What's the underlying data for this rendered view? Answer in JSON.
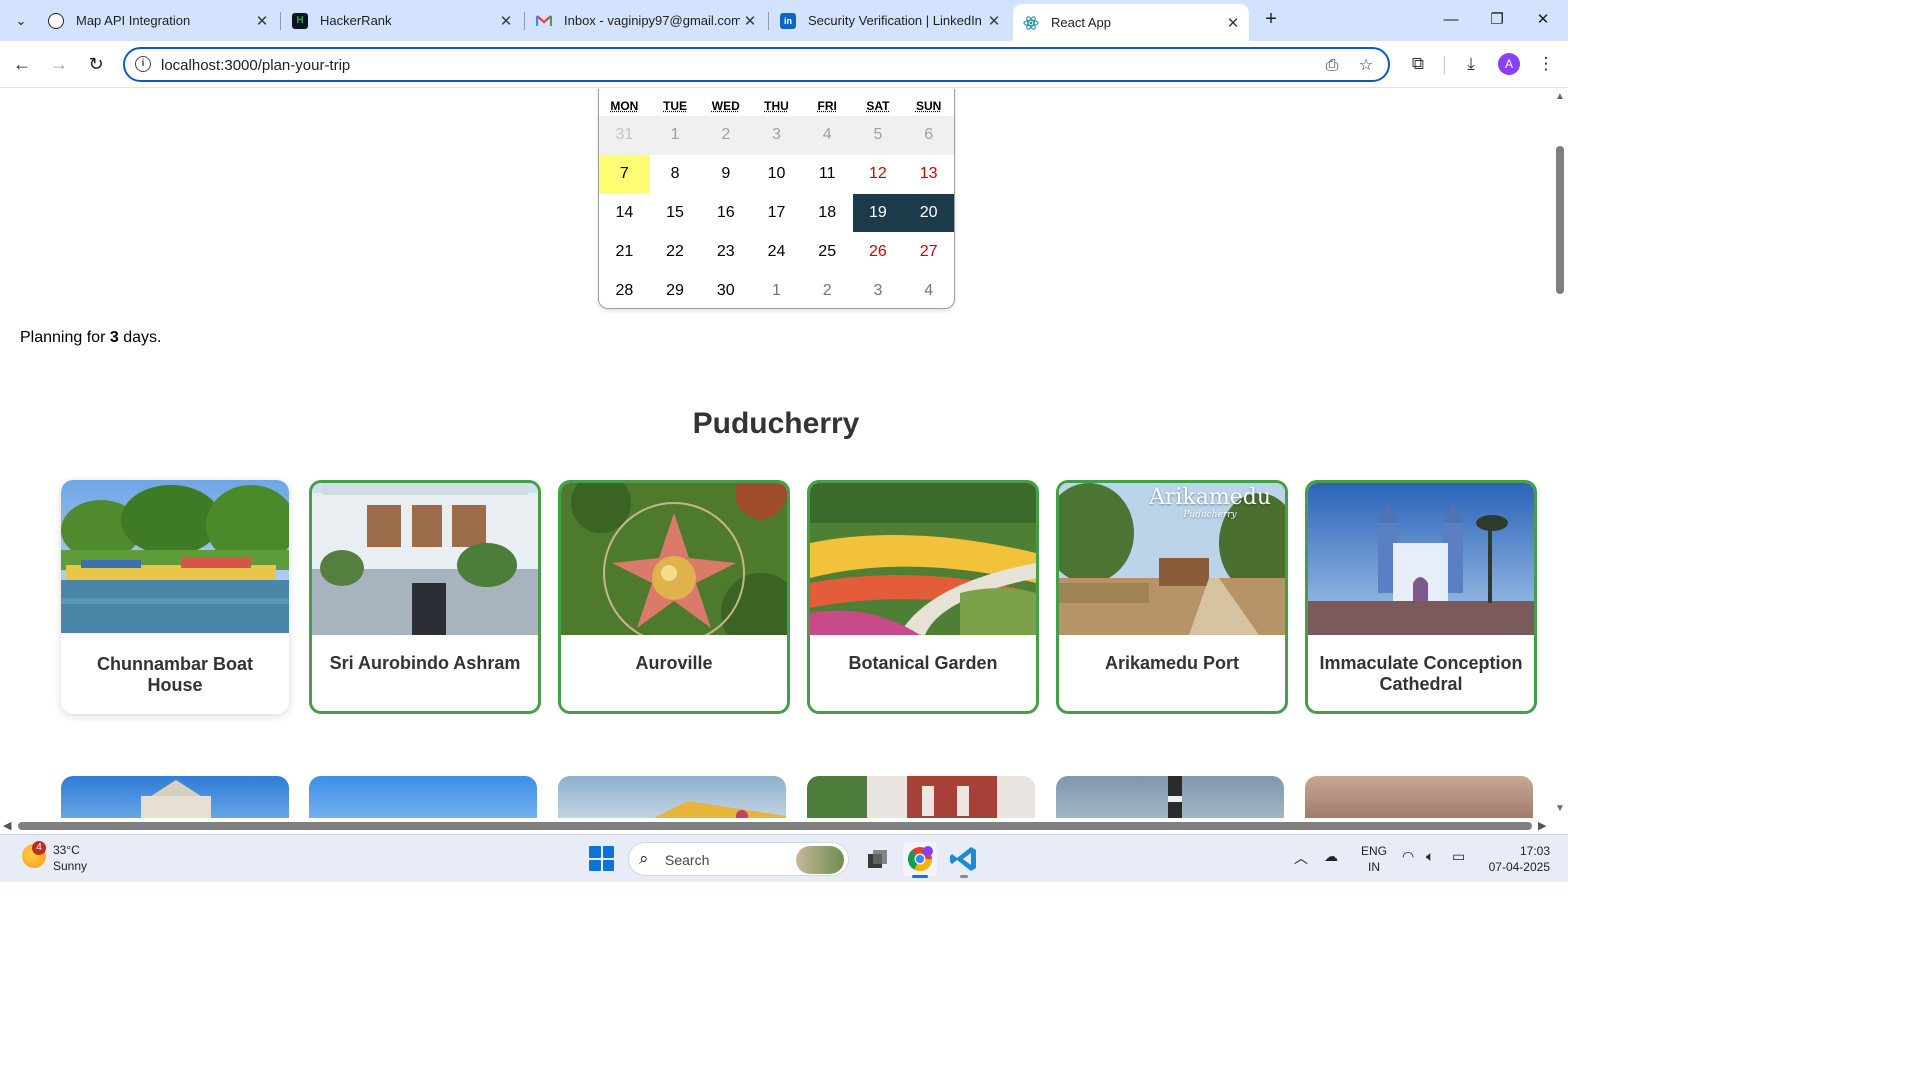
{
  "browser": {
    "tabs": [
      {
        "title": "Map API Integration",
        "favicon": "openai-icon",
        "active": false
      },
      {
        "title": "HackerRank",
        "favicon": "hackerrank-icon",
        "active": false
      },
      {
        "title": "Inbox - vaginipy97@gmail.com",
        "favicon": "gmail-icon",
        "active": false
      },
      {
        "title": "Security Verification | LinkedIn",
        "favicon": "linkedin-icon",
        "active": false
      },
      {
        "title": "React App",
        "favicon": "react-icon",
        "active": true
      }
    ],
    "url": "localhost:3000/plan-your-trip",
    "profile_initial": "A",
    "favicon_hackerrank_text": "H",
    "favicon_linkedin_text": "in"
  },
  "calendar": {
    "weekdays": [
      "MON",
      "TUE",
      "WED",
      "THU",
      "FRI",
      "SAT",
      "SUN"
    ],
    "weeks": [
      [
        "31",
        "1",
        "2",
        "3",
        "4",
        "5",
        "6"
      ],
      [
        "7",
        "8",
        "9",
        "10",
        "11",
        "12",
        "13"
      ],
      [
        "14",
        "15",
        "16",
        "17",
        "18",
        "19",
        "20"
      ],
      [
        "21",
        "22",
        "23",
        "24",
        "25",
        "26",
        "27"
      ],
      [
        "28",
        "29",
        "30",
        "1",
        "2",
        "3",
        "4"
      ]
    ],
    "today": "7",
    "selected": [
      "19",
      "20"
    ],
    "colors": {
      "today": "#ffff76",
      "selected": "#1b3b4b",
      "weekend": "#d10000"
    }
  },
  "planning": {
    "prefix": "Planning for",
    "days": "3",
    "suffix": "days."
  },
  "region": {
    "title": "Puducherry"
  },
  "places": [
    {
      "name": "Chunnambar Boat House",
      "selected": false
    },
    {
      "name": "Sri Aurobindo Ashram",
      "selected": true
    },
    {
      "name": "Auroville",
      "selected": true
    },
    {
      "name": "Botanical Garden",
      "selected": true
    },
    {
      "name": "Arikamedu Port",
      "selected": true,
      "image_caption": "Arikamedu",
      "image_subcaption": "Puducherry"
    },
    {
      "name": "Immaculate Conception Cathedral",
      "selected": true
    }
  ],
  "accent_color": "#43a047",
  "taskbar": {
    "weather_temp": "33°C",
    "weather_desc": "Sunny",
    "weather_badge": "4",
    "search_label": "Search",
    "lang_line1": "ENG",
    "lang_line2": "IN",
    "time": "17:03",
    "date": "07-04-2025"
  }
}
